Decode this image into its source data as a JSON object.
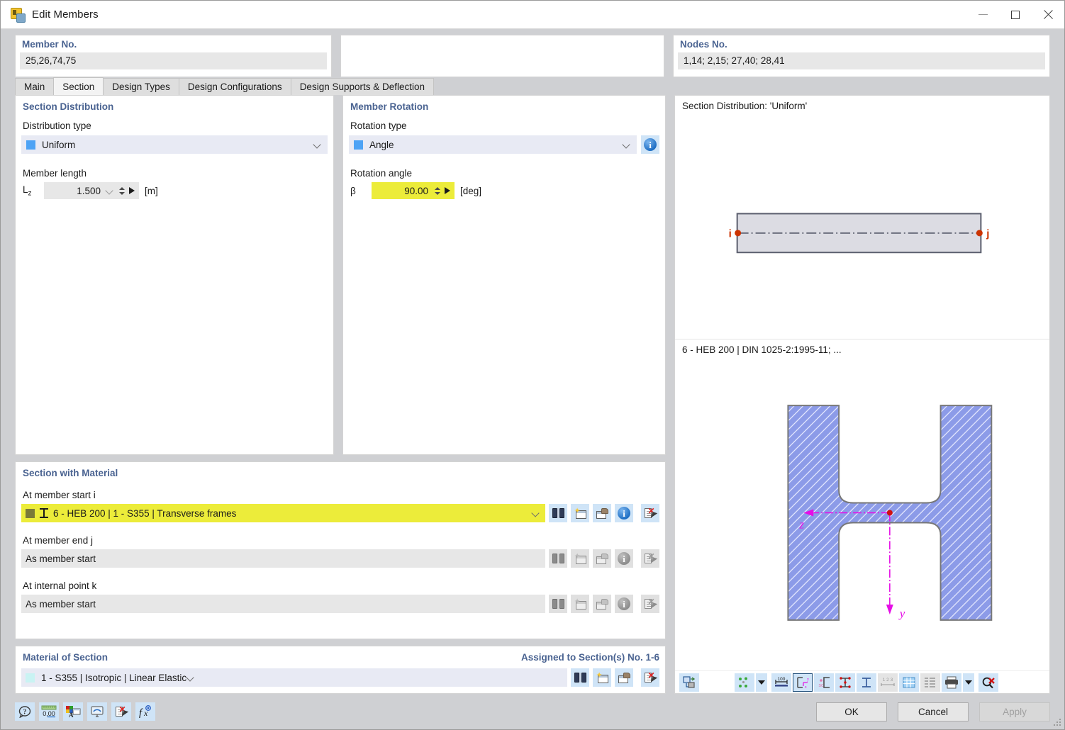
{
  "window": {
    "title": "Edit Members",
    "icon": "app-icon",
    "minimize": "minimize",
    "maximize": "maximize",
    "close": "close"
  },
  "header": {
    "member_no_label": "Member No.",
    "member_no_value": "25,26,74,75",
    "middle_label": "",
    "middle_value": "",
    "nodes_no_label": "Nodes No.",
    "nodes_no_value": "1,14; 2,15; 27,40; 28,41"
  },
  "tabs": [
    {
      "label": "Main",
      "active": false
    },
    {
      "label": "Section",
      "active": true
    },
    {
      "label": "Design Types",
      "active": false
    },
    {
      "label": "Design Configurations",
      "active": false
    },
    {
      "label": "Design Supports & Deflection",
      "active": false
    }
  ],
  "section_distribution": {
    "title": "Section Distribution",
    "distribution_type_label": "Distribution type",
    "distribution_type_value": "Uniform",
    "member_length_label": "Member length",
    "length_symbol": "L",
    "length_subscript": "z",
    "length_value": "1.500",
    "length_unit": "[m]"
  },
  "member_rotation": {
    "title": "Member Rotation",
    "rotation_type_label": "Rotation type",
    "rotation_type_value": "Angle",
    "rotation_angle_label": "Rotation angle",
    "angle_symbol": "β",
    "angle_value": "90.00",
    "angle_unit": "[deg]"
  },
  "section_with_material": {
    "title": "Section with Material",
    "rows": [
      {
        "label": "At member start i",
        "value": "6 - HEB 200 | 1 - S355 | Transverse frames",
        "highlighted": true
      },
      {
        "label": "At member end j",
        "value": "As member start",
        "highlighted": false
      },
      {
        "label": "At internal point k",
        "value": "As member start",
        "highlighted": false
      }
    ],
    "row_buttons": [
      "library-icon",
      "new-section-icon",
      "open-section-icon",
      "info-icon",
      "delete-icon"
    ]
  },
  "material_of_section": {
    "title": "Material of Section",
    "assigned_text": "Assigned to Section(s) No. 1-6",
    "value": "1 - S355 | Isotropic | Linear Elastic",
    "buttons": [
      "library-icon",
      "new-material-icon",
      "open-material-icon",
      "delete-icon"
    ]
  },
  "preview": {
    "distribution_caption": "Section Distribution: 'Uniform'",
    "node_start_label": "i",
    "node_end_label": "j",
    "section_caption": "6 - HEB 200 | DIN 1025-2:1995-11; ...",
    "axis_z_label": "z",
    "axis_y_label": "y",
    "toolbar": [
      {
        "name": "render-mode-icon",
        "state": "enabled"
      },
      {
        "name": "point-display-icon",
        "state": "enabled"
      },
      {
        "name": "point-display-dropdown-icon",
        "state": "enabled"
      },
      {
        "name": "dimensions-icon",
        "state": "enabled"
      },
      {
        "name": "axis-system-icon",
        "state": "selected"
      },
      {
        "name": "shear-center-icon",
        "state": "enabled"
      },
      {
        "name": "stress-points-icon",
        "state": "enabled"
      },
      {
        "name": "section-parts-icon",
        "state": "enabled"
      },
      {
        "name": "numbering-icon",
        "state": "disabled"
      },
      {
        "name": "grid-icon",
        "state": "enabled"
      },
      {
        "name": "table-icon",
        "state": "disabled"
      },
      {
        "name": "print-icon",
        "state": "enabled"
      },
      {
        "name": "print-dropdown-icon",
        "state": "enabled"
      },
      {
        "name": "zoom-reset-icon",
        "state": "enabled"
      }
    ]
  },
  "bottom_toolbar": [
    {
      "name": "help-icon"
    },
    {
      "name": "units-decimals-icon"
    },
    {
      "name": "display-properties-icon"
    },
    {
      "name": "view-mode-icon"
    },
    {
      "name": "delete-object-icon"
    },
    {
      "name": "formula-icon"
    }
  ],
  "dialog_buttons": {
    "ok": "OK",
    "cancel": "Cancel",
    "apply": "Apply",
    "apply_disabled": true
  },
  "colors": {
    "accent_header": "#4a6391",
    "highlight_yellow": "#ecec3a",
    "combo_blue": "#e8eaf4",
    "icon_button_blue": "#cfe4f7",
    "node_red": "#cc3300",
    "axis_magenta": "#e60ee6",
    "steel_blue": "#8c9be8"
  }
}
